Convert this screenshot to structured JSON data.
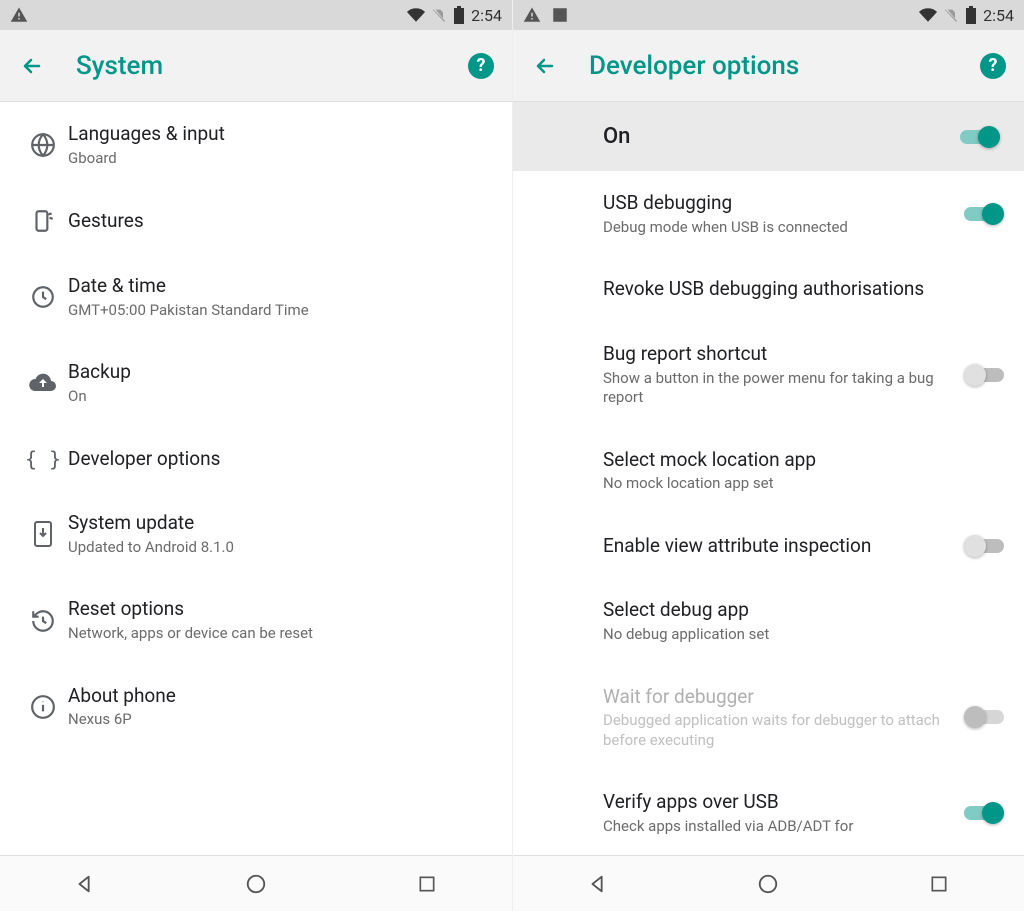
{
  "status": {
    "time": "2:54"
  },
  "left": {
    "title": "System",
    "items": [
      {
        "icon": "globe",
        "title": "Languages & input",
        "sub": "Gboard"
      },
      {
        "icon": "gesture",
        "title": "Gestures",
        "sub": ""
      },
      {
        "icon": "clock",
        "title": "Date & time",
        "sub": "GMT+05:00 Pakistan Standard Time"
      },
      {
        "icon": "cloud-up",
        "title": "Backup",
        "sub": "On"
      },
      {
        "icon": "braces",
        "title": "Developer options",
        "sub": ""
      },
      {
        "icon": "update",
        "title": "System update",
        "sub": "Updated to Android 8.1.0"
      },
      {
        "icon": "restore",
        "title": "Reset options",
        "sub": "Network, apps or device can be reset"
      },
      {
        "icon": "info",
        "title": "About phone",
        "sub": "Nexus 6P"
      }
    ]
  },
  "right": {
    "title": "Developer options",
    "master": {
      "label": "On",
      "on": true
    },
    "items": [
      {
        "title": "USB debugging",
        "sub": "Debug mode when USB is connected",
        "switch": true,
        "on": true
      },
      {
        "title": "Revoke USB debugging authorisations",
        "sub": "",
        "switch": false
      },
      {
        "title": "Bug report shortcut",
        "sub": "Show a button in the power menu for taking a bug report",
        "switch": true,
        "on": false
      },
      {
        "title": "Select mock location app",
        "sub": "No mock location app set",
        "switch": false
      },
      {
        "title": "Enable view attribute inspection",
        "sub": "",
        "switch": true,
        "on": false
      },
      {
        "title": "Select debug app",
        "sub": "No debug application set",
        "switch": false
      },
      {
        "title": "Wait for debugger",
        "sub": "Debugged application waits for debugger to attach before executing",
        "switch": true,
        "on": false,
        "disabled": true
      },
      {
        "title": "Verify apps over USB",
        "sub": "Check apps installed via ADB/ADT for",
        "switch": true,
        "on": true
      }
    ]
  },
  "help_glyph": "?"
}
